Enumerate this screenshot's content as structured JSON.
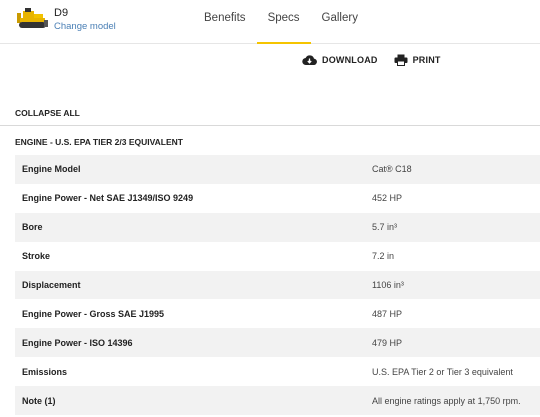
{
  "header": {
    "model_name": "D9",
    "change_model": "Change model",
    "thumbnail_icon": "bulldozer-thumbnail",
    "tabs": [
      {
        "label": "Benefits",
        "active": false
      },
      {
        "label": "Specs",
        "active": true
      },
      {
        "label": "Gallery",
        "active": false
      }
    ],
    "accent_color": "#f5c400"
  },
  "actions": {
    "download_label": "DOWNLOAD",
    "download_icon": "cloud-download-icon",
    "print_label": "PRINT",
    "print_icon": "printer-icon"
  },
  "collapse_all": "COLLAPSE ALL",
  "section": {
    "title": "ENGINE - U.S. EPA TIER 2/3 EQUIVALENT",
    "rows": [
      {
        "label": "Engine Model",
        "value": "Cat® C18"
      },
      {
        "label": "Engine Power - Net SAE J1349/ISO 9249",
        "value": "452 HP"
      },
      {
        "label": "Bore",
        "value": "5.7 in³"
      },
      {
        "label": "Stroke",
        "value": "7.2 in"
      },
      {
        "label": "Displacement",
        "value": "1106 in³"
      },
      {
        "label": "Engine Power - Gross SAE J1995",
        "value": "487 HP"
      },
      {
        "label": "Engine Power - ISO 14396",
        "value": "479 HP"
      },
      {
        "label": "Emissions",
        "value": "U.S. EPA Tier 2 or Tier 3 equivalent"
      },
      {
        "label": "Note (1)",
        "value": "All engine ratings apply at 1,750 rpm."
      }
    ]
  }
}
